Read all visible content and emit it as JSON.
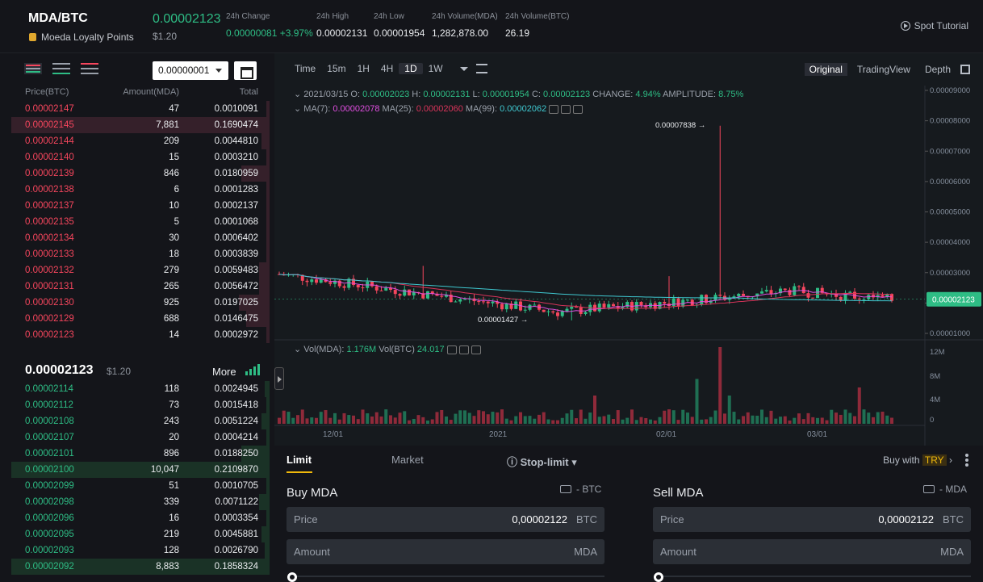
{
  "header": {
    "pair": "MDA/BTC",
    "loyalty": "Moeda Loyalty Points",
    "last_price": "0.00002123",
    "last_usd": "$1.20",
    "stats": [
      {
        "k": "24h Change",
        "v": "0.00000081 +3.97%",
        "green": true
      },
      {
        "k": "24h High",
        "v": "0.00002131"
      },
      {
        "k": "24h Low",
        "v": "0.00001954"
      },
      {
        "k": "24h Volume(MDA)",
        "v": "1,282,878.00"
      },
      {
        "k": "24h Volume(BTC)",
        "v": "26.19"
      }
    ],
    "tutorial": "Spot Tutorial"
  },
  "orderbook": {
    "precision": "0.00000001",
    "col_price": "Price(BTC)",
    "col_amount": "Amount(MDA)",
    "col_total": "Total",
    "asks": [
      {
        "p": "0.00002147",
        "a": "47",
        "t": "0.0010091",
        "d": 0.01
      },
      {
        "p": "0.00002145",
        "a": "7,881",
        "t": "0.1690474",
        "d": 1.0
      },
      {
        "p": "0.00002144",
        "a": "209",
        "t": "0.0044810",
        "d": 0.03
      },
      {
        "p": "0.00002140",
        "a": "15",
        "t": "0.0003210",
        "d": 0.01
      },
      {
        "p": "0.00002139",
        "a": "846",
        "t": "0.0180959",
        "d": 0.11
      },
      {
        "p": "0.00002138",
        "a": "6",
        "t": "0.0001283",
        "d": 0.01
      },
      {
        "p": "0.00002137",
        "a": "10",
        "t": "0.0002137",
        "d": 0.01
      },
      {
        "p": "0.00002135",
        "a": "5",
        "t": "0.0001068",
        "d": 0.01
      },
      {
        "p": "0.00002134",
        "a": "30",
        "t": "0.0006402",
        "d": 0.01
      },
      {
        "p": "0.00002133",
        "a": "18",
        "t": "0.0003839",
        "d": 0.01
      },
      {
        "p": "0.00002132",
        "a": "279",
        "t": "0.0059483",
        "d": 0.04
      },
      {
        "p": "0.00002131",
        "a": "265",
        "t": "0.0056472",
        "d": 0.04
      },
      {
        "p": "0.00002130",
        "a": "925",
        "t": "0.0197025",
        "d": 0.12
      },
      {
        "p": "0.00002129",
        "a": "688",
        "t": "0.0146475",
        "d": 0.09
      },
      {
        "p": "0.00002123",
        "a": "14",
        "t": "0.0002972",
        "d": 0.01
      }
    ],
    "mid_price": "0.00002123",
    "mid_usd": "$1.20",
    "more": "More",
    "bids": [
      {
        "p": "0.00002114",
        "a": "118",
        "t": "0.0024945",
        "d": 0.02
      },
      {
        "p": "0.00002112",
        "a": "73",
        "t": "0.0015418",
        "d": 0.01
      },
      {
        "p": "0.00002108",
        "a": "243",
        "t": "0.0051224",
        "d": 0.03
      },
      {
        "p": "0.00002107",
        "a": "20",
        "t": "0.0004214",
        "d": 0.01
      },
      {
        "p": "0.00002101",
        "a": "896",
        "t": "0.0188250",
        "d": 0.11
      },
      {
        "p": "0.00002100",
        "a": "10,047",
        "t": "0.2109870",
        "d": 1.0
      },
      {
        "p": "0.00002099",
        "a": "51",
        "t": "0.0010705",
        "d": 0.01
      },
      {
        "p": "0.00002098",
        "a": "339",
        "t": "0.0071122",
        "d": 0.04
      },
      {
        "p": "0.00002096",
        "a": "16",
        "t": "0.0003354",
        "d": 0.01
      },
      {
        "p": "0.00002095",
        "a": "219",
        "t": "0.0045881",
        "d": 0.03
      },
      {
        "p": "0.00002093",
        "a": "128",
        "t": "0.0026790",
        "d": 0.02
      },
      {
        "p": "0.00002092",
        "a": "8,883",
        "t": "0.1858324",
        "d": 1.0
      }
    ]
  },
  "chart": {
    "timeframes": [
      "Time",
      "15m",
      "1H",
      "4H",
      "1D",
      "1W"
    ],
    "active_tf": "1D",
    "views": [
      "Original",
      "TradingView",
      "Depth"
    ],
    "active_view": "Original",
    "ohlc": {
      "date": "2021/03/15",
      "o_label": "O:",
      "o": "0.00002023",
      "h_label": "H:",
      "h": "0.00002131",
      "l_label": "L:",
      "l": "0.00001954",
      "c_label": "C:",
      "c": "0.00002123",
      "chg_label": "CHANGE:",
      "chg": "4.94%",
      "amp_label": "AMPLITUDE:",
      "amp": "8.75%"
    },
    "ma": {
      "ma7_label": "MA(7):",
      "ma7": "0.00002078",
      "ma25_label": "MA(25):",
      "ma25": "0.00002060",
      "ma99_label": "MA(99):",
      "ma99": "0.00002062"
    },
    "vol": {
      "mda_label": "Vol(MDA):",
      "mda": "1.176M",
      "btc_label": "Vol(BTC)",
      "btc": "24.017"
    },
    "high_label": "0.00007838",
    "low_label": "0.00001427",
    "price_tag": "0.00002123",
    "y_ticks": [
      "0.00009000",
      "0.00008000",
      "0.00007000",
      "0.00006000",
      "0.00005000",
      "0.00004000",
      "0.00003000",
      "0.00002000",
      "0.00001000"
    ],
    "vol_ticks": [
      "12M",
      "8M",
      "4M",
      "0"
    ],
    "x_ticks": [
      "12/01",
      "2021",
      "02/01",
      "03/01"
    ],
    "colors": {
      "up": "#2ebd85",
      "down": "#f6465d",
      "ma7": "#e04ee0",
      "ma25": "#d9345a",
      "ma99": "#3fc8d0"
    }
  },
  "trade": {
    "tabs": [
      "Limit",
      "Market",
      "Stop-limit"
    ],
    "buy_with": "Buy with",
    "currency": "TRY",
    "buy": {
      "title": "Buy MDA",
      "balance": "- BTC",
      "price_label": "Price",
      "price": "0,00002122",
      "price_unit": "BTC",
      "amount_label": "Amount",
      "amount_unit": "MDA"
    },
    "sell": {
      "title": "Sell MDA",
      "balance": "- MDA",
      "price_label": "Price",
      "price": "0,00002122",
      "price_unit": "BTC",
      "amount_label": "Amount",
      "amount_unit": "MDA"
    }
  }
}
